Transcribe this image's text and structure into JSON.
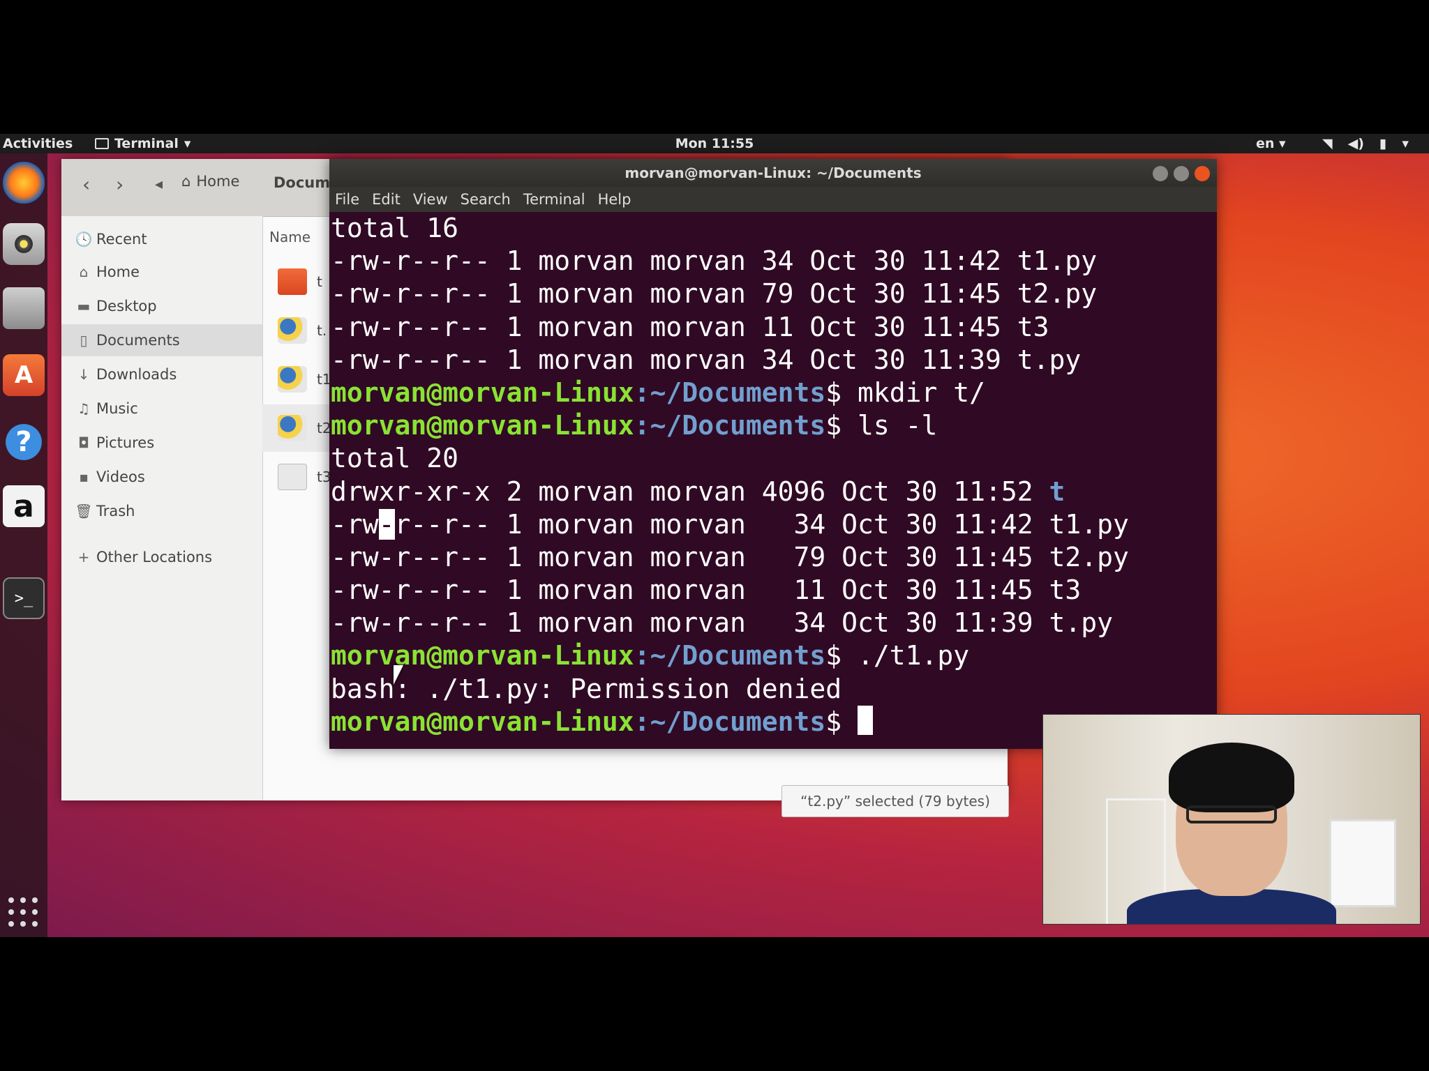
{
  "topbar": {
    "activities": "Activities",
    "app_name": "Terminal",
    "app_menu_arrow": "▾",
    "clock": "Mon 11:55",
    "language": "en ▾",
    "status_icons": [
      "wifi-icon",
      "volume-icon",
      "battery-icon",
      "system-menu-icon"
    ]
  },
  "dock": {
    "items": [
      "firefox-icon",
      "rhythmbox-icon",
      "files-icon",
      "software-icon",
      "help-icon",
      "amazon-icon",
      "terminal-icon",
      "show-apps-icon"
    ],
    "software_glyph": "A",
    "help_glyph": "?",
    "amazon_glyph": "a",
    "terminal_glyph": ">_"
  },
  "files": {
    "breadcrumb_home": "Home",
    "breadcrumb_current": "Docum",
    "sidebar": [
      {
        "label": "Recent",
        "icon": "clock-icon",
        "glyph": "🕓"
      },
      {
        "label": "Home",
        "icon": "home-icon",
        "glyph": "⌂"
      },
      {
        "label": "Desktop",
        "icon": "folder-icon",
        "glyph": "▬"
      },
      {
        "label": "Documents",
        "icon": "document-icon",
        "glyph": "▯"
      },
      {
        "label": "Downloads",
        "icon": "download-icon",
        "glyph": "↓"
      },
      {
        "label": "Music",
        "icon": "music-icon",
        "glyph": "♫"
      },
      {
        "label": "Pictures",
        "icon": "camera-icon",
        "glyph": "◘"
      },
      {
        "label": "Videos",
        "icon": "video-icon",
        "glyph": "▪"
      },
      {
        "label": "Trash",
        "icon": "trash-icon",
        "glyph": "🗑"
      },
      {
        "label": "Other Locations",
        "icon": "plus-icon",
        "glyph": "+"
      }
    ],
    "column_name": "Name",
    "rows": [
      {
        "name": "t",
        "type": "folder"
      },
      {
        "name": "t.",
        "type": "py"
      },
      {
        "name": "t1",
        "type": "py"
      },
      {
        "name": "t2",
        "type": "py"
      },
      {
        "name": "t3",
        "type": "txt"
      }
    ],
    "status": "“t2.py” selected  (79 bytes)"
  },
  "terminal": {
    "title": "morvan@morvan-Linux: ~/Documents",
    "menu": [
      "File",
      "Edit",
      "View",
      "Search",
      "Terminal",
      "Help"
    ],
    "prompt_user": "morvan@morvan-Linux",
    "prompt_path": ":~/Documents",
    "prompt_symbol": "$ ",
    "lines": [
      "total 16",
      "-rw-r--r-- 1 morvan morvan 34 Oct 30 11:42 t1.py",
      "-rw-r--r-- 1 morvan morvan 79 Oct 30 11:45 t2.py",
      "-rw-r--r-- 1 morvan morvan 11 Oct 30 11:45 t3",
      "-rw-r--r-- 1 morvan morvan 34 Oct 30 11:39 t.py"
    ],
    "cmd_mkdir": "mkdir t/",
    "cmd_ls": "ls -l",
    "lines2_total": "total 20",
    "dir_line_prefix": "drwxr-xr-x 2 morvan morvan 4096 Oct 30 11:52 ",
    "dir_name": "t",
    "hl_line_start": "-rw",
    "hl_char": "-",
    "hl_line_rest": "r--r-- 1 morvan morvan   34 Oct 30 11:42 t1.py",
    "lines2": [
      "-rw-r--r-- 1 morvan morvan   79 Oct 30 11:45 t2.py",
      "-rw-r--r-- 1 morvan morvan   11 Oct 30 11:45 t3",
      "-rw-r--r-- 1 morvan morvan   34 Oct 30 11:39 t.py"
    ],
    "cmd_run": "./t1.py",
    "error_line": "bash: ./t1.py: Permission denied"
  },
  "colors": {
    "terminal_bg": "#300a24",
    "prompt_user": "#8ae234",
    "prompt_path": "#729fcf",
    "accent": "#e95420"
  }
}
